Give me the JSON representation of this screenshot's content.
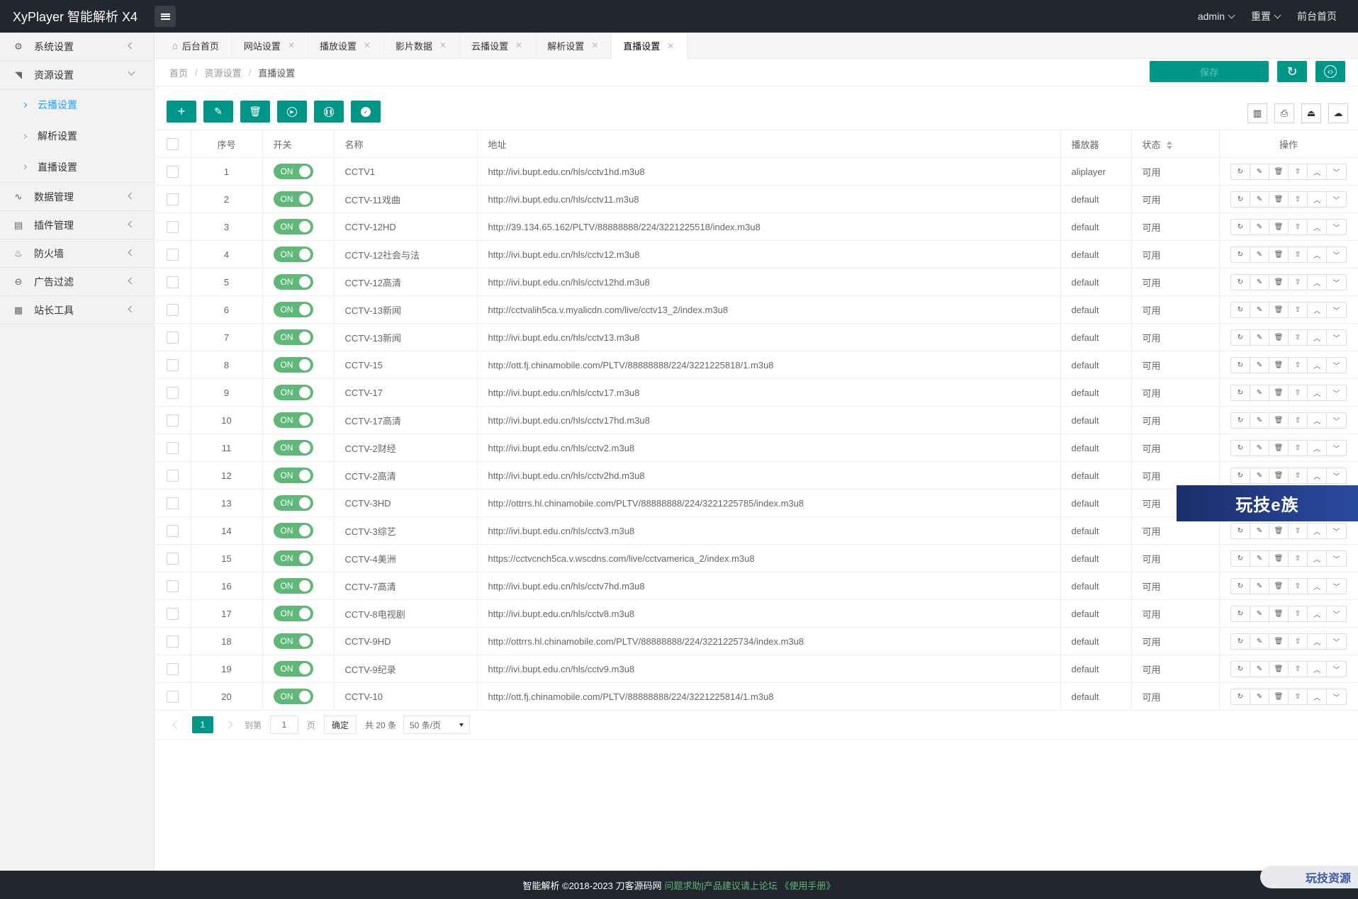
{
  "app": {
    "brand": "XyPlayer 智能解析 X4",
    "user": "admin",
    "reset": "重置",
    "front_home": "前台首页"
  },
  "sidebar": {
    "items": [
      {
        "label": "系统设置",
        "icon": "gear-icon"
      },
      {
        "label": "资源设置",
        "icon": "rss-icon"
      },
      {
        "label": "数据管理",
        "icon": "pulse-icon"
      },
      {
        "label": "插件管理",
        "icon": "plugin-icon"
      },
      {
        "label": "防火墙",
        "icon": "fire-icon"
      },
      {
        "label": "广告过滤",
        "icon": "block-icon"
      },
      {
        "label": "站长工具",
        "icon": "tools-icon"
      }
    ],
    "sub_items": [
      "云播设置",
      "解析设置",
      "直播设置"
    ]
  },
  "tabs": [
    {
      "label": "后台首页"
    },
    {
      "label": "网站设置"
    },
    {
      "label": "播放设置"
    },
    {
      "label": "影片数据"
    },
    {
      "label": "云播设置"
    },
    {
      "label": "解析设置"
    },
    {
      "label": "直播设置"
    }
  ],
  "breadcrumb": {
    "home": "首页",
    "section": "资源设置",
    "current": "直播设置",
    "save_label": "保存"
  },
  "table": {
    "headers": {
      "index": "序号",
      "switch": "开关",
      "name": "名称",
      "url": "地址",
      "player": "播放器",
      "status": "状态",
      "ops": "操作"
    },
    "switch_on": "ON",
    "rows": [
      {
        "id": "1",
        "name": "CCTV1",
        "url": "http://ivi.bupt.edu.cn/hls/cctv1hd.m3u8",
        "player": "aliplayer",
        "status": "可用"
      },
      {
        "id": "2",
        "name": "CCTV-11戏曲",
        "url": "http://ivi.bupt.edu.cn/hls/cctv11.m3u8",
        "player": "default",
        "status": "可用"
      },
      {
        "id": "3",
        "name": "CCTV-12HD",
        "url": "http://39.134.65.162/PLTV/88888888/224/3221225518/index.m3u8",
        "player": "default",
        "status": "可用"
      },
      {
        "id": "4",
        "name": "CCTV-12社会与法",
        "url": "http://ivi.bupt.edu.cn/hls/cctv12.m3u8",
        "player": "default",
        "status": "可用"
      },
      {
        "id": "5",
        "name": "CCTV-12高清",
        "url": "http://ivi.bupt.edu.cn/hls/cctv12hd.m3u8",
        "player": "default",
        "status": "可用"
      },
      {
        "id": "6",
        "name": "CCTV-13新闻",
        "url": "http://cctvalih5ca.v.myalicdn.com/live/cctv13_2/index.m3u8",
        "player": "default",
        "status": "可用"
      },
      {
        "id": "7",
        "name": "CCTV-13新闻",
        "url": "http://ivi.bupt.edu.cn/hls/cctv13.m3u8",
        "player": "default",
        "status": "可用"
      },
      {
        "id": "8",
        "name": "CCTV-15",
        "url": "http://ott.fj.chinamobile.com/PLTV/88888888/224/3221225818/1.m3u8",
        "player": "default",
        "status": "可用"
      },
      {
        "id": "9",
        "name": "CCTV-17",
        "url": "http://ivi.bupt.edu.cn/hls/cctv17.m3u8",
        "player": "default",
        "status": "可用"
      },
      {
        "id": "10",
        "name": "CCTV-17高清",
        "url": "http://ivi.bupt.edu.cn/hls/cctv17hd.m3u8",
        "player": "default",
        "status": "可用"
      },
      {
        "id": "11",
        "name": "CCTV-2财经",
        "url": "http://ivi.bupt.edu.cn/hls/cctv2.m3u8",
        "player": "default",
        "status": "可用"
      },
      {
        "id": "12",
        "name": "CCTV-2高清",
        "url": "http://ivi.bupt.edu.cn/hls/cctv2hd.m3u8",
        "player": "default",
        "status": "可用"
      },
      {
        "id": "13",
        "name": "CCTV-3HD",
        "url": "http://ottrrs.hl.chinamobile.com/PLTV/88888888/224/3221225785/index.m3u8",
        "player": "default",
        "status": "可用"
      },
      {
        "id": "14",
        "name": "CCTV-3综艺",
        "url": "http://ivi.bupt.edu.cn/hls/cctv3.m3u8",
        "player": "default",
        "status": "可用"
      },
      {
        "id": "15",
        "name": "CCTV-4美洲",
        "url": "https://cctvcnch5ca.v.wscdns.com/live/cctvamerica_2/index.m3u8",
        "player": "default",
        "status": "可用"
      },
      {
        "id": "16",
        "name": "CCTV-7高清",
        "url": "http://ivi.bupt.edu.cn/hls/cctv7hd.m3u8",
        "player": "default",
        "status": "可用"
      },
      {
        "id": "17",
        "name": "CCTV-8电视剧",
        "url": "http://ivi.bupt.edu.cn/hls/cctv8.m3u8",
        "player": "default",
        "status": "可用"
      },
      {
        "id": "18",
        "name": "CCTV-9HD",
        "url": "http://ottrrs.hl.chinamobile.com/PLTV/88888888/224/3221225734/index.m3u8",
        "player": "default",
        "status": "可用"
      },
      {
        "id": "19",
        "name": "CCTV-9纪录",
        "url": "http://ivi.bupt.edu.cn/hls/cctv9.m3u8",
        "player": "default",
        "status": "可用"
      },
      {
        "id": "20",
        "name": "CCTV-10",
        "url": "http://ott.fj.chinamobile.com/PLTV/88888888/224/3221225814/1.m3u8",
        "player": "default",
        "status": "可用"
      }
    ]
  },
  "pager": {
    "current": "1",
    "goto_label": "到第",
    "page_input": "1",
    "page_unit": "页",
    "confirm": "确定",
    "total": "共 20 条",
    "per_page": "50 条/页"
  },
  "footer": {
    "text": "智能解析 ©2018-2023 刀客源码网",
    "link": "问题求助|产品建议请上论坛 《使用手册》"
  },
  "watermarks": {
    "banner": "玩技e族",
    "corner": "玩技资源"
  },
  "colors": {
    "primary": "#009688",
    "switch_on": "#5fb878",
    "header_bg": "#23262e",
    "active_link": "#1e9fff"
  }
}
